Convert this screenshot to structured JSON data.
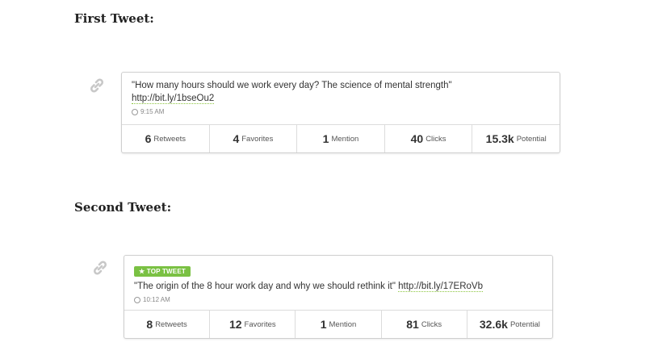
{
  "first_heading": "First Tweet:",
  "second_heading": "Second Tweet:",
  "tweets": [
    {
      "badge": "",
      "text": "\"How many hours should we work every day? The science of mental strength\"",
      "url": "http://bit.ly/1bseOu2",
      "time": "9:15 AM",
      "stats": [
        {
          "num": "6",
          "label": "Retweets"
        },
        {
          "num": "4",
          "label": "Favorites"
        },
        {
          "num": "1",
          "label": "Mention"
        },
        {
          "num": "40",
          "label": "Clicks"
        },
        {
          "num": "15.3k",
          "label": "Potential"
        }
      ]
    },
    {
      "badge": "★ TOP TWEET",
      "text": "\"The origin of the 8 hour work day and why we should rethink it\"",
      "url": "http://bit.ly/17ERoVb",
      "time": "10:12 AM",
      "stats": [
        {
          "num": "8",
          "label": "Retweets"
        },
        {
          "num": "12",
          "label": "Favorites"
        },
        {
          "num": "1",
          "label": "Mention"
        },
        {
          "num": "81",
          "label": "Clicks"
        },
        {
          "num": "32.6k",
          "label": "Potential"
        }
      ]
    }
  ],
  "colors": {
    "badge_bg": "#7ac143",
    "url_underline": "#8cc63f"
  },
  "icons": {
    "link": "link-icon",
    "clock": "clock-icon",
    "star": "star-icon"
  }
}
